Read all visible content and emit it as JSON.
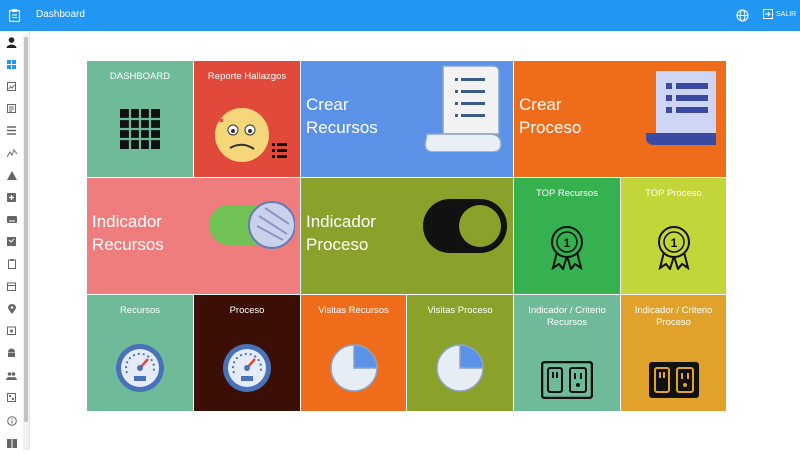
{
  "header": {
    "title": "Dashboard",
    "logout_label": "SALIR"
  },
  "sidebar": {
    "icons": [
      "user-icon",
      "dashboard-icon",
      "image-icon",
      "document-icon",
      "list-icon",
      "chart-line-icon",
      "warning-icon",
      "add-box-icon",
      "keyboard-icon",
      "assignment-icon",
      "clipboard-icon",
      "calendar-icon",
      "location-icon",
      "event-icon",
      "android-icon",
      "people-icon",
      "qr-icon",
      "info-icon",
      "book-icon"
    ]
  },
  "tiles": {
    "dashboard": {
      "label": "DASHBOARD",
      "color": "#6fba99"
    },
    "reporte_hallazgos": {
      "label": "Reporte Hallazgos",
      "color": "#e14a3a"
    },
    "crear_recursos": {
      "line1": "Crear",
      "line2": "Recursos",
      "color": "#5b91e6"
    },
    "crear_proceso": {
      "line1": "Crear",
      "line2": "Proceso",
      "color": "#ef6c1a"
    },
    "indicador_recursos": {
      "line1": "Indicador",
      "line2": "Recursos",
      "color": "#f07d7d"
    },
    "indicador_proceso": {
      "line1": "Indicador",
      "line2": "Proceso",
      "color": "#8ba22a"
    },
    "top_recursos": {
      "label": "TOP Recursos",
      "color": "#35b14f"
    },
    "top_proceso": {
      "label": "TOP Proceso",
      "color": "#c3d639"
    },
    "recursos": {
      "label": "Recursos",
      "color": "#6fba99"
    },
    "proceso": {
      "label": "Proceso",
      "color": "#3b0f06"
    },
    "visitas_recursos": {
      "label": "Visitas Recursos",
      "color": "#ef6c1a"
    },
    "visitas_proceso": {
      "label": "Visitas Proceso",
      "color": "#8ba22a"
    },
    "indicador_criterio_recursos": {
      "line1": "Indicador / Criterio",
      "line2": "Recursos",
      "color": "#6fba99"
    },
    "indicador_criterio_proceso": {
      "line1": "Indicador / Criterio",
      "line2": "Proceso",
      "color": "#e0a22a"
    }
  }
}
